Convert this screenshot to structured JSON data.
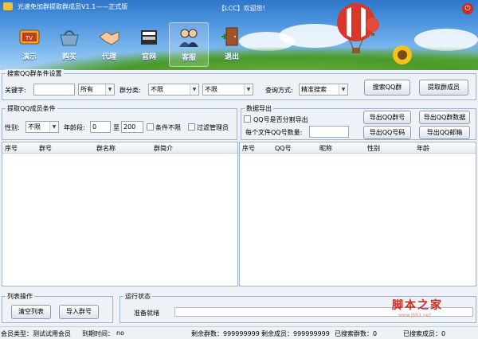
{
  "window": {
    "title": "光速免加群提取群成员V1.1——正式版",
    "welcome": "【LCC】欢迎您!"
  },
  "nav": [
    {
      "label": "演示",
      "icon": "tv-icon"
    },
    {
      "label": "购买",
      "icon": "basket-icon"
    },
    {
      "label": "代理",
      "icon": "handshake-icon"
    },
    {
      "label": "官网",
      "icon": "books-icon"
    },
    {
      "label": "客服",
      "icon": "support-people-icon"
    },
    {
      "label": "退出",
      "icon": "exit-door-icon"
    }
  ],
  "search_group": {
    "title": "搜索QQ群条件设置",
    "keyword_label": "关键字:",
    "keyword_value": "",
    "scope_value": "所有",
    "category_label": "群分类:",
    "category1_value": "不限",
    "category2_value": "不限",
    "query_label": "查询方式:",
    "query_value": "精准搜索",
    "search_btn": "搜索QQ群",
    "extract_btn": "提取群成员"
  },
  "member_group": {
    "title": "提取QQ成员条件",
    "gender_label": "性别:",
    "gender_value": "不限",
    "age_label": "年龄段:",
    "age_from": "0",
    "age_to_label": "至",
    "age_to": "200",
    "no_limit_label": "条件不限",
    "filter_admin_label": "过滤管理员"
  },
  "export_group": {
    "title": "数据导出",
    "split_label": "QQ号是否分割导出",
    "per_file_label": "每个文件QQ号数量:",
    "per_file_value": "",
    "btn_export_qq_group": "导出QQ群号",
    "btn_export_group_data": "导出QQ群数据",
    "btn_export_qq_number": "导出QQ号码",
    "btn_export_qq_mail": "导出QQ邮箱"
  },
  "left_table": {
    "headers": [
      "序号",
      "群号",
      "群名称",
      "群简介"
    ]
  },
  "right_table": {
    "headers": [
      "序号",
      "QQ号",
      "昵称",
      "性别",
      "年龄"
    ]
  },
  "list_ops": {
    "title": "列表操作",
    "clear_btn": "清空列表",
    "import_btn": "导入群号"
  },
  "run_status": {
    "title": "运行状态",
    "status_text": "准备就绪",
    "progress": 0
  },
  "status_bar": {
    "member_type_label": "会员类型：测试试用会员",
    "expire_label": "到期时间：",
    "expire_value": "no",
    "remaining_groups": "剩余群数：999999999",
    "remaining_members": "剩余成员：999999999",
    "searched_groups": "已搜索群数：0",
    "searched_members": "已搜索成员：0"
  },
  "watermark": {
    "text": "脚本之家",
    "url": "www.jb51.net"
  },
  "colors": {
    "header_top": "#2f76c9",
    "header_bottom": "#a9d3f4",
    "border": "#9db4cf",
    "watermark": "#d12a1f"
  }
}
